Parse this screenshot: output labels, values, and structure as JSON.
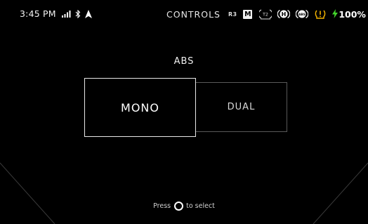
{
  "status_bar": {
    "time": "3:45 PM",
    "signal_icon": "signal-bars-icon",
    "bluetooth_icon": "bluetooth-icon",
    "navigation_icon": "navigation-arrow-icon",
    "screen_title": "CONTROLS",
    "bike_model": "R3",
    "ride_mode": "M",
    "traction_icon_label": "T2",
    "hill_hold_icon_label": "H",
    "abs_icon_label": "ABS",
    "warning_icon": "tire-pressure-warning-icon",
    "battery_icon": "charging-bolt-icon",
    "battery_percent": "100%",
    "colors": {
      "battery_green": "#44d62c",
      "warning_amber": "#f5b400"
    }
  },
  "main": {
    "heading": "ABS",
    "options": [
      {
        "label": "MONO",
        "selected": true
      },
      {
        "label": "DUAL",
        "selected": false
      }
    ]
  },
  "footer": {
    "hint_prefix": "Press",
    "hint_icon": "circle-button-icon",
    "hint_suffix": "to select"
  }
}
